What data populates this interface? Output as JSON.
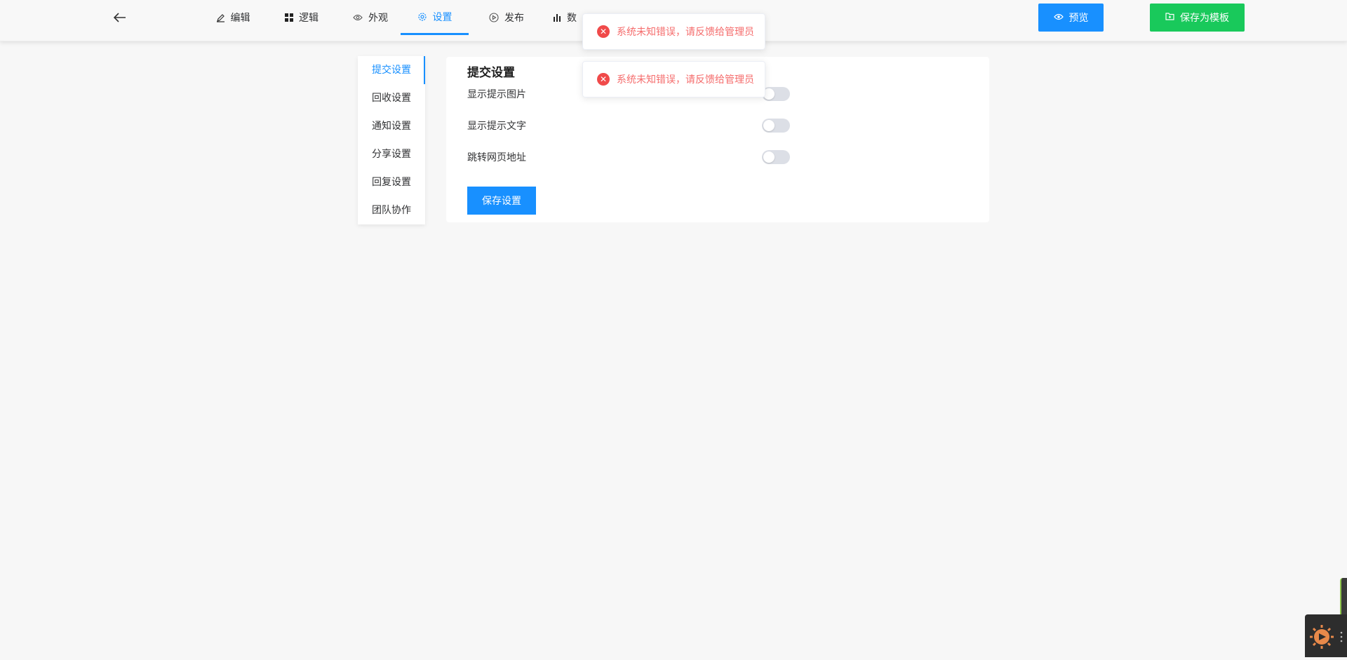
{
  "topbar": {
    "tabs": [
      {
        "label": "编辑",
        "icon": "pen-icon"
      },
      {
        "label": "逻辑",
        "icon": "grid-icon"
      },
      {
        "label": "外观",
        "icon": "eye-icon"
      },
      {
        "label": "设置",
        "icon": "gear-icon"
      },
      {
        "label": "发布",
        "icon": "play-circle-icon"
      },
      {
        "label": "数",
        "icon": "bar-chart-icon"
      }
    ],
    "active_tab": "设置",
    "preview_label": "预览",
    "save_template_label": "保存为模板"
  },
  "sidebar": {
    "items": [
      {
        "label": "提交设置"
      },
      {
        "label": "回收设置"
      },
      {
        "label": "通知设置"
      },
      {
        "label": "分享设置"
      },
      {
        "label": "回复设置"
      },
      {
        "label": "团队协作"
      }
    ],
    "active_item": "提交设置"
  },
  "panel": {
    "title": "提交设置",
    "rows": [
      {
        "label": "显示提示图片",
        "enabled": false
      },
      {
        "label": "显示提示文字",
        "enabled": false
      },
      {
        "label": "跳转网页地址",
        "enabled": false
      }
    ],
    "save_label": "保存设置"
  },
  "toasts": [
    {
      "message": "系统未知错误，请反馈给管理员"
    },
    {
      "message": "系统未知错误，请反馈给管理员"
    }
  ],
  "colors": {
    "primary": "#1890ff",
    "success": "#19c95b",
    "error": "#f56c6c"
  }
}
